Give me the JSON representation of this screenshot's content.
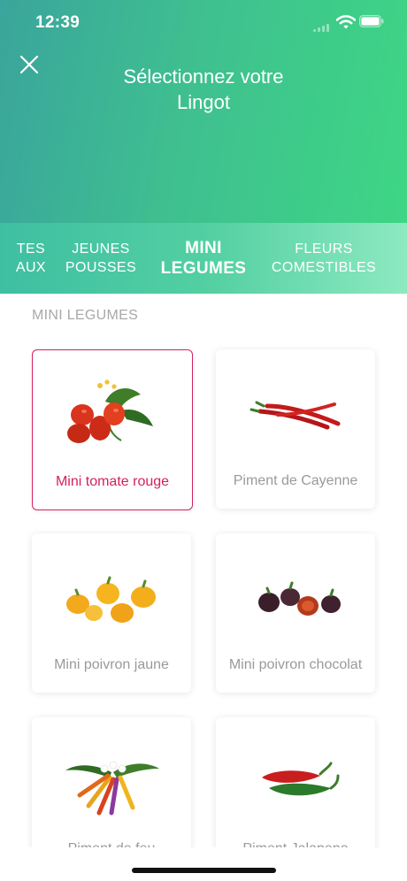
{
  "status_bar": {
    "time": "12:39"
  },
  "header": {
    "title": "Sélectionnez votre\nLingot"
  },
  "tabs": [
    {
      "label": "TES\nAUX"
    },
    {
      "label": "JEUNES\nPOUSSES"
    },
    {
      "label": "MINI\nLEGUMES",
      "active": true
    },
    {
      "label": "FLEURS\nCOMESTIBLES"
    }
  ],
  "section": {
    "title": "MINI LEGUMES"
  },
  "products": [
    {
      "name": "Mini tomate rouge",
      "icon": "tomato-icon",
      "selected": true
    },
    {
      "name": "Piment de Cayenne",
      "icon": "cayenne-pepper-icon"
    },
    {
      "name": "Mini poivron jaune",
      "icon": "yellow-pepper-icon"
    },
    {
      "name": "Mini poivron chocolat",
      "icon": "chocolate-pepper-icon"
    },
    {
      "name": "Piment de feu",
      "icon": "fire-pepper-icon"
    },
    {
      "name": "Piment Jalapeno",
      "icon": "jalapeno-icon"
    }
  ],
  "colors": {
    "accent": "#d4225e",
    "header_start": "#3aa59c",
    "header_end": "#3ed684"
  }
}
